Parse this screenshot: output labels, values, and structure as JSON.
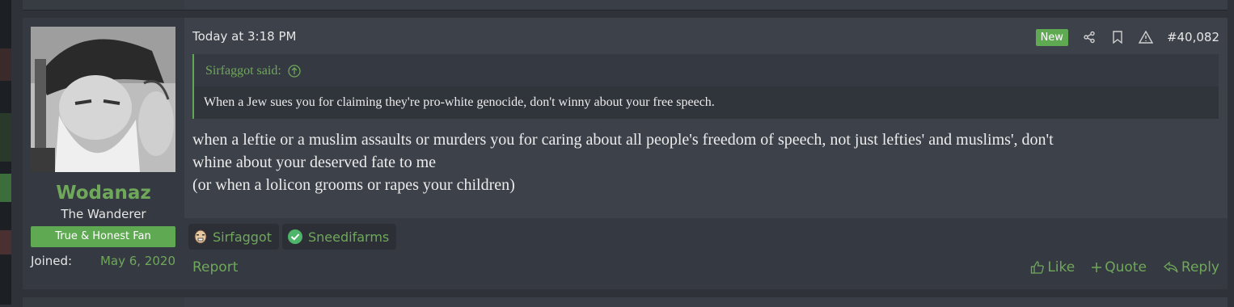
{
  "post": {
    "user": {
      "name": "Wodanaz",
      "title": "The Wanderer",
      "banner": "True & Honest Fan",
      "joined_label": "Joined:",
      "joined_date": "May 6, 2020"
    },
    "timestamp": "Today at 3:18 PM",
    "badge": "New",
    "post_number": "#40,082",
    "quote": {
      "author_line": "Sirfaggot said:",
      "text": "When a Jew sues you for claiming they're pro-white genocide, don't winny about your free speech."
    },
    "body": [
      "when a leftie or a muslim assaults or murders you for caring about all people's freedom of speech, not just lefties' and muslims', don't",
      "whine about your deserved fate to me",
      "(or when a lolicon grooms or rapes your children)"
    ],
    "reactions": [
      {
        "user": "Sirfaggot",
        "icon": "winking-face-icon"
      },
      {
        "user": "Sneedifarms",
        "icon": "check-circle-icon"
      }
    ],
    "report_label": "Report",
    "like_label": "Like",
    "quote_label": "Quote",
    "reply_label": "Reply"
  },
  "colors": {
    "accent": "#6fa85a",
    "badge_green": "#5fa953",
    "post_bg": "#3d414a",
    "user_bg": "#353941",
    "page_bg": "#2f3339"
  }
}
